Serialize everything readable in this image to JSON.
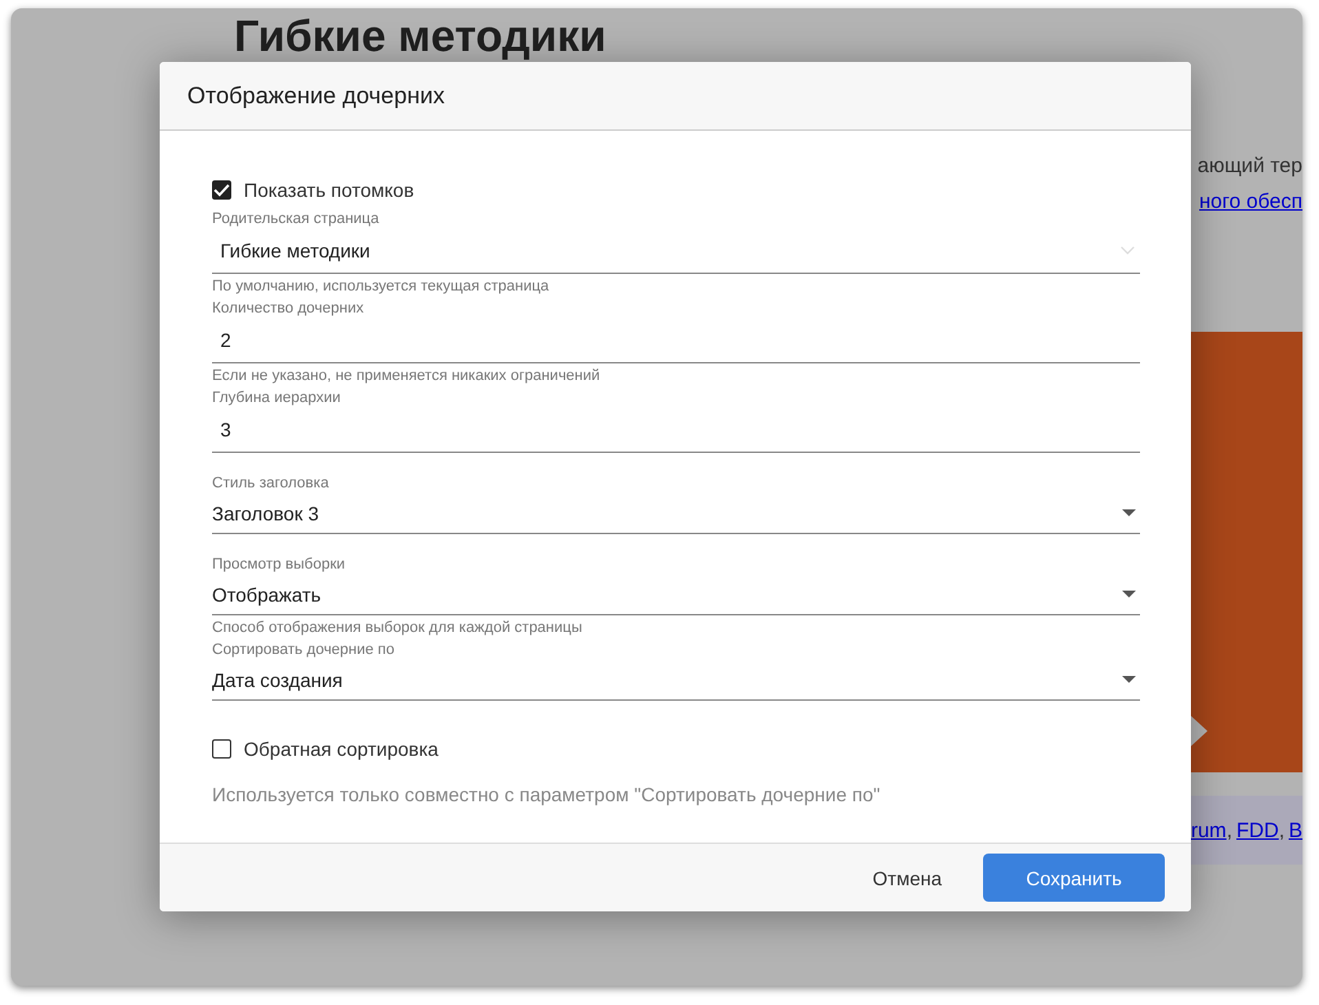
{
  "background_page": {
    "title": "Гибкие методики",
    "text_fragments": [
      {
        "text": "ающий тер",
        "kind": "text"
      },
      {
        "text": "ного обесп",
        "kind": "link"
      }
    ],
    "footer_links": [
      "rum",
      "FDD",
      "B"
    ],
    "link_separator": ","
  },
  "dialog": {
    "title": "Отображение дочерних",
    "fields": [
      {
        "kind": "checkbox",
        "label": "Показать потомков",
        "checked": true
      },
      {
        "kind": "combo",
        "label": "Родительская страница",
        "value": "Гибкие методики",
        "hint": "По умолчанию, используется текущая страница"
      },
      {
        "kind": "input",
        "label": "Количество дочерних",
        "value": "2",
        "hint": "Если не указано, не применяется никаких ограничений"
      },
      {
        "kind": "input",
        "label": "Глубина иерархии",
        "value": "3"
      },
      {
        "kind": "select",
        "label": "Стиль заголовка",
        "value": "Заголовок 3"
      },
      {
        "kind": "select",
        "label": "Просмотр выборки",
        "value": "Отображать",
        "hint": "Способ отображения выборок для каждой страницы"
      },
      {
        "kind": "select",
        "label": "Сортировать дочерние по",
        "value": "Дата создания"
      },
      {
        "kind": "checkbox",
        "label": "Обратная сортировка",
        "checked": false
      },
      {
        "kind": "note",
        "text": "Используется только совместно с параметром \"Сортировать дочерние по\""
      }
    ],
    "buttons": [
      {
        "label": "Отмена",
        "kind": "text"
      },
      {
        "label": "Сохранить",
        "kind": "primary"
      }
    ]
  }
}
